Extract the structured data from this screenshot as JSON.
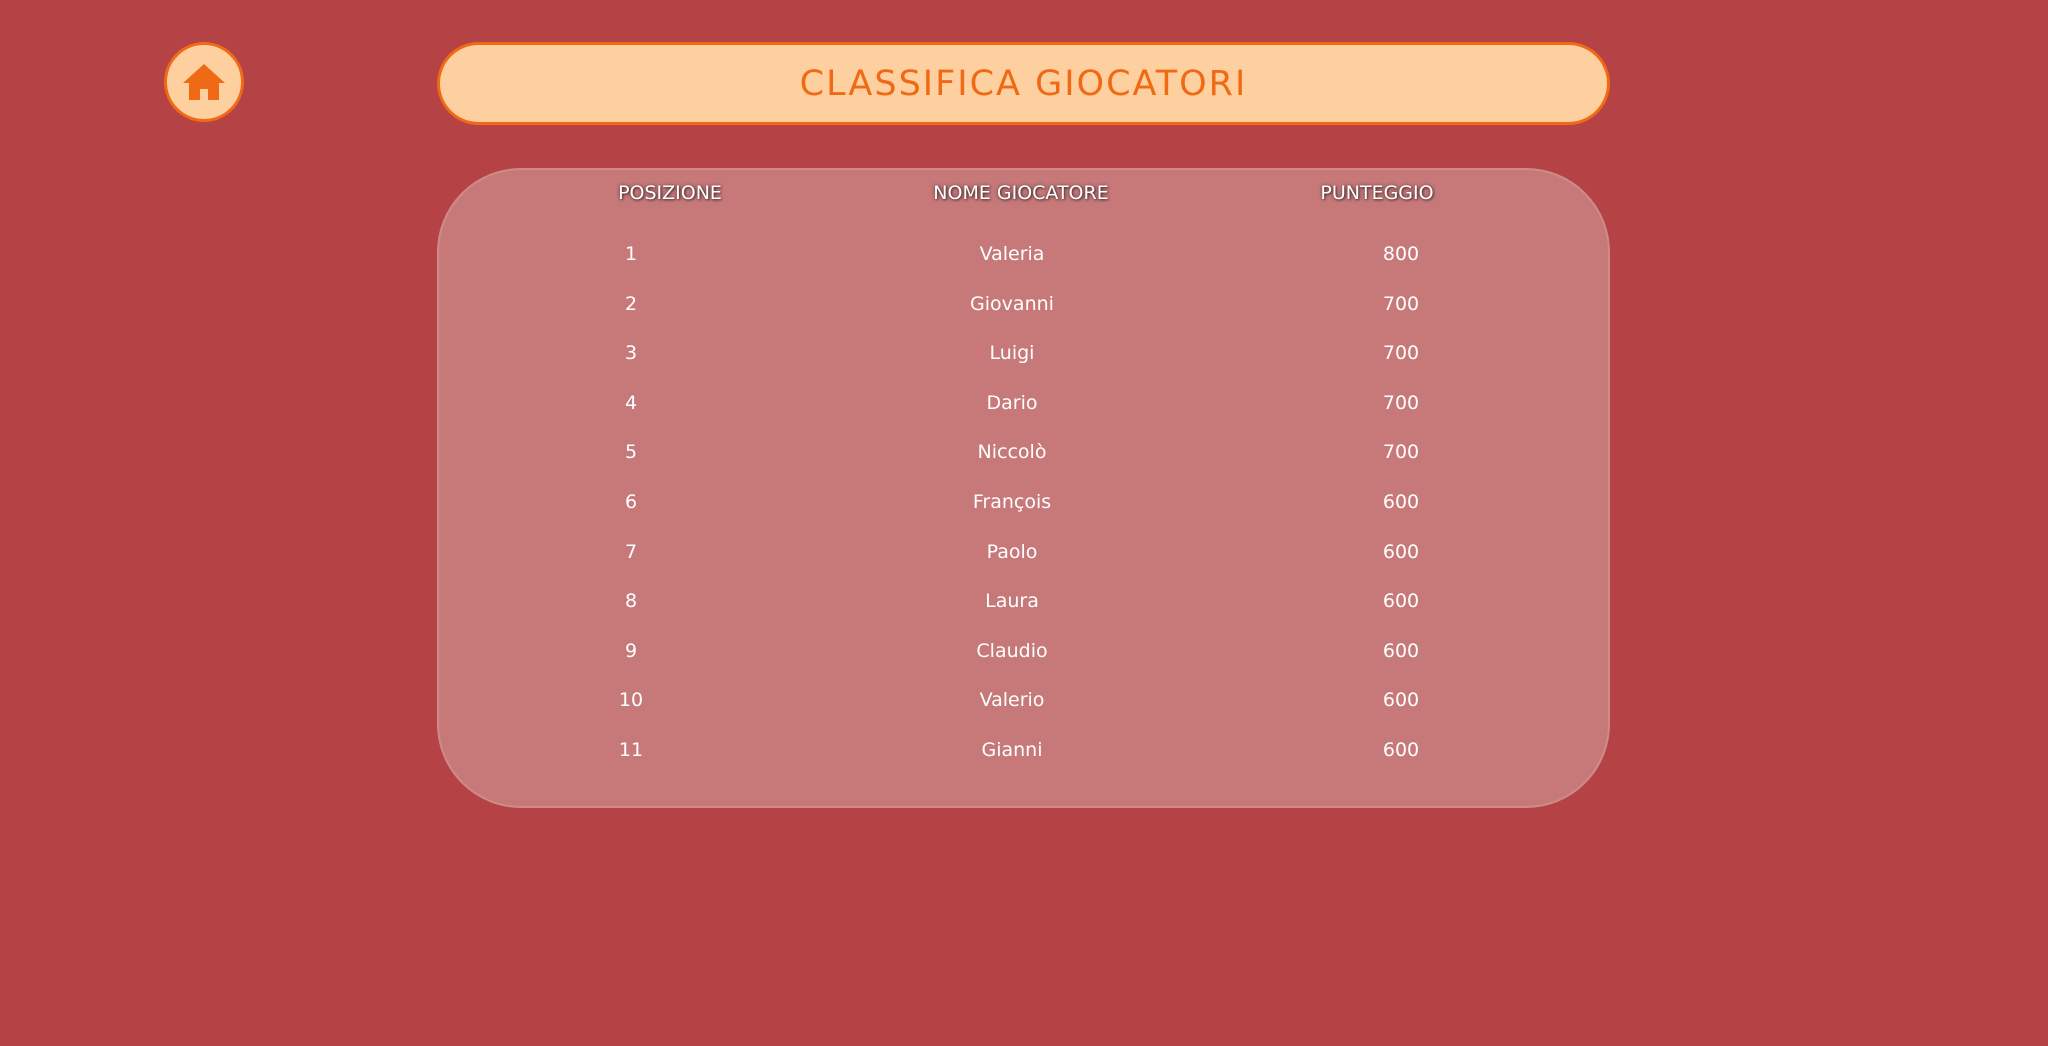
{
  "header": {
    "home_icon": "home-icon",
    "title": "CLASSIFICA GIOCATORI"
  },
  "colors": {
    "background": "#b54244",
    "accent": "#f06a16",
    "pill": "#ffd09f",
    "board": "#c7797a"
  },
  "leaderboard": {
    "columns": [
      "POSIZIONE",
      "NOME GIOCATORE",
      "PUNTEGGIO"
    ],
    "rows": [
      {
        "position": "1",
        "name": "Valeria",
        "score": "800"
      },
      {
        "position": "2",
        "name": "Giovanni",
        "score": "700"
      },
      {
        "position": "3",
        "name": "Luigi",
        "score": "700"
      },
      {
        "position": "4",
        "name": "Dario",
        "score": "700"
      },
      {
        "position": "5",
        "name": "Niccolò",
        "score": "700"
      },
      {
        "position": "6",
        "name": "François",
        "score": "600"
      },
      {
        "position": "7",
        "name": "Paolo",
        "score": "600"
      },
      {
        "position": "8",
        "name": "Laura",
        "score": "600"
      },
      {
        "position": "9",
        "name": "Claudio",
        "score": "600"
      },
      {
        "position": "10",
        "name": "Valerio",
        "score": "600"
      },
      {
        "position": "11",
        "name": "Gianni",
        "score": "600"
      }
    ]
  }
}
